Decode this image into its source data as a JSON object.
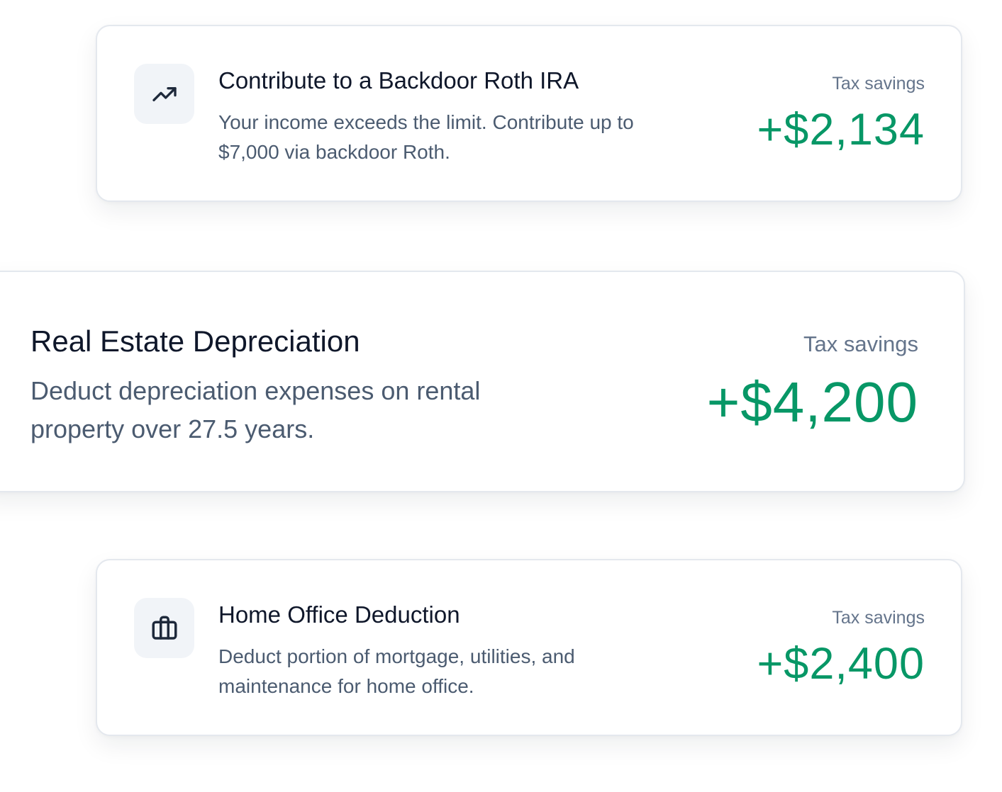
{
  "cards": [
    {
      "icon": "trending-up-icon",
      "title": "Contribute to a Backdoor Roth IRA",
      "description": "Your income exceeds the limit. Contribute up to $7,000 via backdoor Roth.",
      "savings_label": "Tax savings",
      "savings_amount": "+$2,134"
    },
    {
      "title": "Real Estate Depreciation",
      "description": "Deduct depreciation expenses on rental property over 27.5 years.",
      "savings_label": "Tax savings",
      "savings_amount": "+$4,200"
    },
    {
      "icon": "briefcase-icon",
      "title": "Home Office Deduction",
      "description": "Deduct portion of mortgage, utilities, and maintenance for home office.",
      "savings_label": "Tax savings",
      "savings_amount": "+$2,400"
    }
  ],
  "colors": {
    "savings_green": "#079766",
    "title": "#0f172a",
    "description": "#4b5b70",
    "label": "#64748b",
    "icon_bg": "#f1f4f8"
  }
}
